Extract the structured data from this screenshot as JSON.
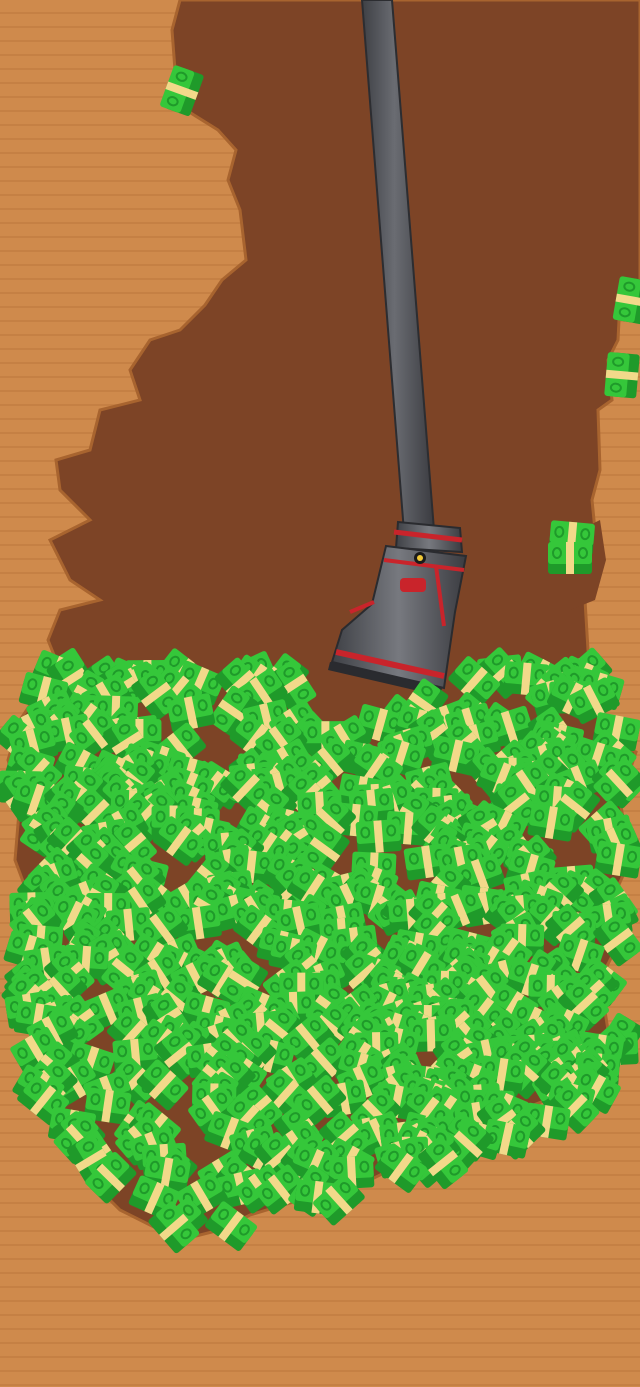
{
  "game": {
    "colors": {
      "ground": "#cf8a4c",
      "ground_stripe": "#b9743a",
      "ground_edge": "#b06a30",
      "dug": "#7d4426",
      "bill_green": "#35c73a",
      "bill_green_dark": "#1f9a2a",
      "bill_band": "#f2d98a",
      "pipe": "#55575c",
      "pipe_dark": "#3e4045",
      "nozzle_red": "#c9242b"
    },
    "objects": {
      "vacuum_tool": "vacuum-hose-nozzle",
      "loot": "cash-bundle-pile",
      "terrain": "diggable-dirt"
    }
  }
}
